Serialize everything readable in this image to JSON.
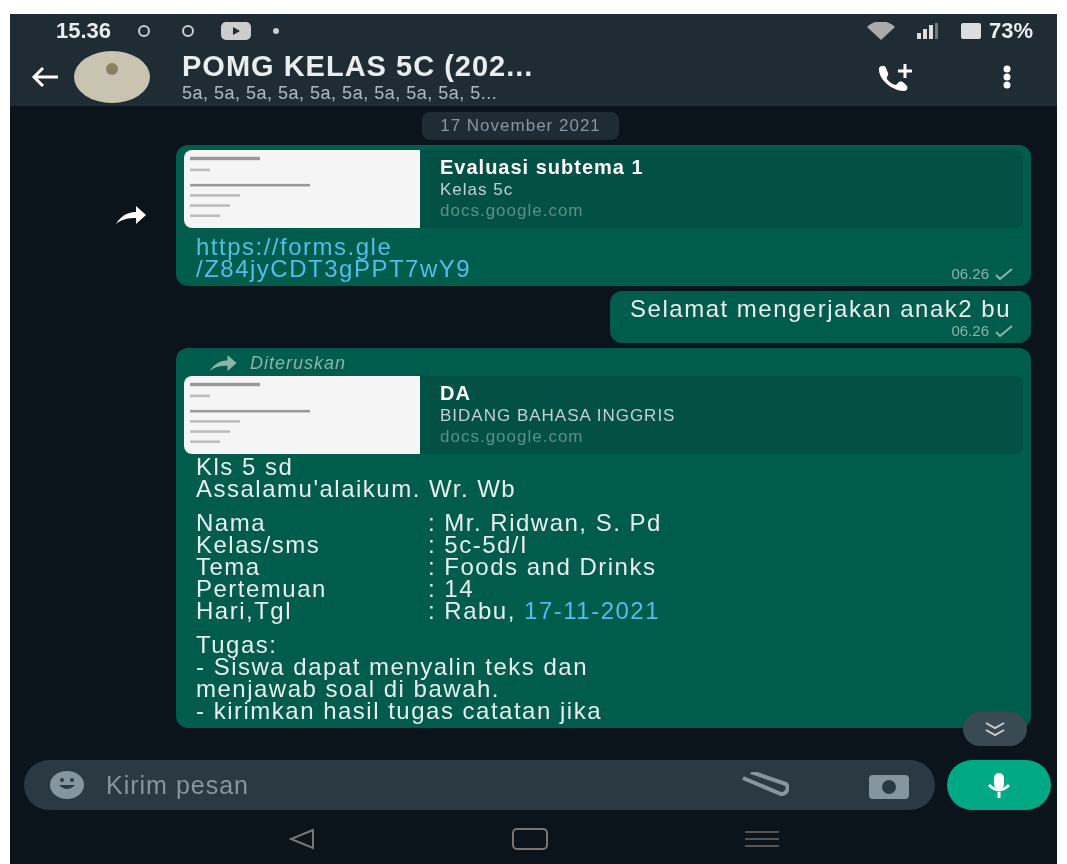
{
  "status_bar": {
    "time": "15.36",
    "battery": "73%"
  },
  "header": {
    "title": "POMG KELAS 5C (202...",
    "subtitle": "5a, 5a, 5a, 5a, 5a, 5a, 5a, 5a, 5a, 5..."
  },
  "date_chip": "17 November 2021",
  "messages": [
    {
      "kind": "link",
      "preview": {
        "title": "Evaluasi subtema 1",
        "subtitle": "Kelas 5c",
        "domain": "docs.google.com"
      },
      "link_lines": [
        "https://forms.gle",
        "/Z84jyCDT3gPPT7wY9"
      ],
      "time": "06.26"
    },
    {
      "kind": "text",
      "text": "Selamat mengerjakan anak2 bu",
      "time": "06.26"
    },
    {
      "kind": "forwarded",
      "forwarded_label": "Diteruskan",
      "preview": {
        "title": "DA",
        "subtitle": "BIDANG BAHASA INGGRIS",
        "domain": "docs.google.com"
      },
      "intro": [
        "Kls 5 sd",
        "Assalamu'alaikum. Wr. Wb"
      ],
      "fields": [
        {
          "label": "Nama",
          "value": ": Mr. Ridwan, S. Pd"
        },
        {
          "label": "Kelas/sms",
          "value": ": 5c-5d/I"
        },
        {
          "label": "Tema",
          "value": ": Foods and Drinks"
        },
        {
          "label": "Pertemuan",
          "value": ": 14"
        },
        {
          "label": "Hari,Tgl",
          "value": ": Rabu, ",
          "link": "17-11-2021"
        }
      ],
      "task_lines": [
        "Tugas:",
        "- Siswa dapat menyalin teks dan",
        "menjawab soal di bawah.",
        "- kirimkan hasil tugas catatan jika"
      ]
    }
  ],
  "composer": {
    "placeholder": "Kirim pesan"
  }
}
